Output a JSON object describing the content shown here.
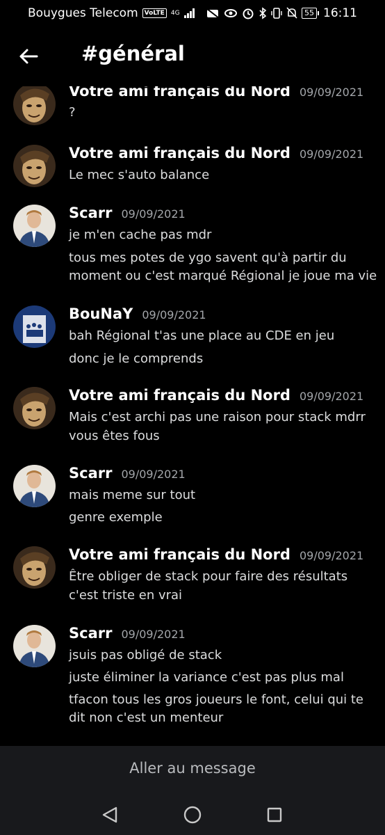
{
  "status_bar": {
    "carrier": "Bouygues Telecom",
    "volte": "VoLTE",
    "network": "4G",
    "battery": "55",
    "time": "16:11"
  },
  "header": {
    "title": "#général"
  },
  "messages": [
    {
      "author": "Votre ami français du Nord",
      "timestamp": "09/09/2021",
      "avatar": "anime-avatar",
      "lines": [
        "?"
      ]
    },
    {
      "author": "Votre ami français du Nord",
      "timestamp": "09/09/2021",
      "avatar": "anime-avatar",
      "lines": [
        "Le mec s'auto balance"
      ]
    },
    {
      "author": "Scarr",
      "timestamp": "09/09/2021",
      "avatar": "suit-avatar",
      "lines": [
        "je m'en cache pas mdr",
        "tous mes potes de ygo savent qu'à partir du",
        "moment ou c'est marqué Régional je joue ma vie"
      ]
    },
    {
      "author": "BouNaY",
      "timestamp": "09/09/2021",
      "avatar": "team-avatar",
      "lines": [
        "bah Régional t'as une place au CDE en jeu",
        "donc je le comprends"
      ]
    },
    {
      "author": "Votre ami français du Nord",
      "timestamp": "09/09/2021",
      "avatar": "anime-avatar",
      "lines": [
        "Mais c'est archi pas une raison pour stack mdrr",
        "vous êtes fous"
      ]
    },
    {
      "author": "Scarr",
      "timestamp": "09/09/2021",
      "avatar": "suit-avatar",
      "lines": [
        "mais meme sur tout",
        "genre exemple"
      ]
    },
    {
      "author": "Votre ami français du Nord",
      "timestamp": "09/09/2021",
      "avatar": "anime-avatar",
      "lines": [
        "Être obliger de stack pour faire des résultats",
        "c'est triste en vrai"
      ]
    },
    {
      "author": "Scarr",
      "timestamp": "09/09/2021",
      "avatar": "suit-avatar",
      "lines": [
        "jsuis pas obligé de stack",
        "juste éliminer la variance c'est pas plus mal",
        "tfacon tous les gros joueurs le font, celui qui te",
        "dit non c'est un menteur"
      ]
    }
  ],
  "bottom": {
    "jump_label": "Aller au message"
  },
  "colors": {
    "background": "#000000",
    "author": "#ffffff",
    "message_text": "#dcddde",
    "timestamp": "#a3a6aa",
    "bottom_bar": "#18191c"
  }
}
